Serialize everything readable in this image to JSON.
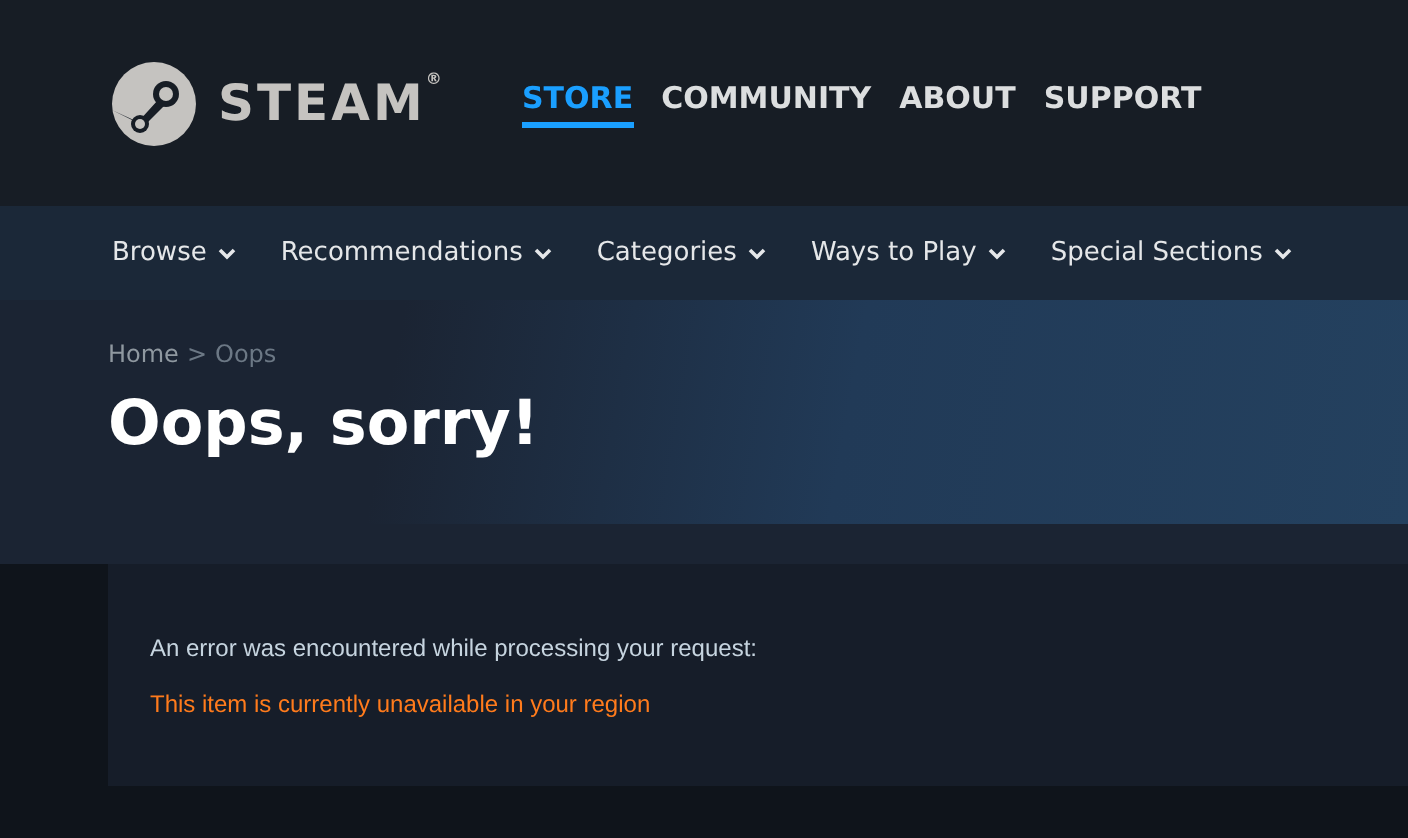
{
  "header": {
    "logo_text": "STEAM$^{®}$",
    "nav": [
      {
        "label": "STORE",
        "selected": true
      },
      {
        "label": "COMMUNITY",
        "selected": false
      },
      {
        "label": "ABOUT",
        "selected": false
      },
      {
        "label": "SUPPORT",
        "selected": false
      }
    ]
  },
  "subnav": [
    {
      "label": "Browse"
    },
    {
      "label": "Recommendations"
    },
    {
      "label": "Categories"
    },
    {
      "label": "Ways to Play"
    },
    {
      "label": "Special Sections"
    }
  ],
  "breadcrumb": [
    {
      "label": "Home"
    },
    {
      "label": ">"
    },
    {
      "label": "Oops"
    }
  ],
  "title": "Oops, sorry!",
  "error": {
    "message": "An error was encountered while processing your request:",
    "detail": "This item is currently unavailable in your region"
  }
}
